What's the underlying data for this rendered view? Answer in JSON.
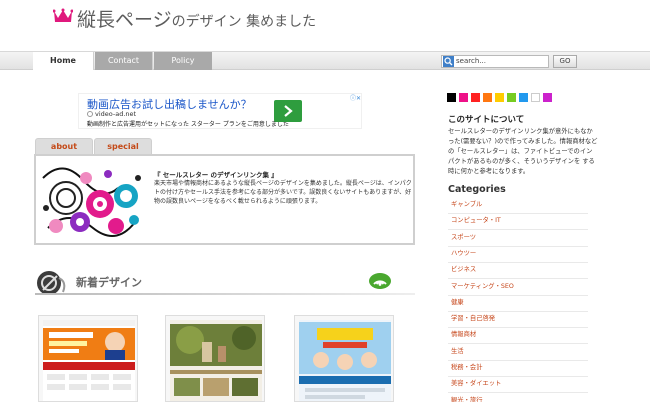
{
  "header": {
    "title_main": "縦長ページ",
    "title_sub": "のデザイン 集めました"
  },
  "nav": {
    "home": "Home",
    "contact": "Contact",
    "policy": "Policy"
  },
  "search": {
    "value": "search...",
    "go": "GO"
  },
  "ad": {
    "headline": "動画広告お試し出稿しませんか？",
    "url": "video-ad.net",
    "description": "動画制作と広告運用がセットになった スターター プランをご用意しました"
  },
  "tabs": {
    "about": "about",
    "special": "special"
  },
  "about_box": {
    "title": "『 セールスレター のデザインリンク集 』",
    "text": "楽天市場や情報商材にあるような縦長ページのデザインを集めました。縦長ページは、インパクトの付け方やセールス手法を参考になる部分が多いです。誤数良くないサイトもありますが、好物の誤数良いページをなるべく載せられるように頑張ります。"
  },
  "new_section": {
    "heading": "新着デザイン"
  },
  "colors": [
    "#000000",
    "#ee1188",
    "#ff2222",
    "#ff7711",
    "#ffcc00",
    "#77cc22",
    "#2299ee",
    "#ffffff",
    "#cc22cc"
  ],
  "sidebar": {
    "about_title": "このサイトについて",
    "about_text": "セールスレターのデザインリンク集が意外にもなかった(需要ない？)ので作ってみました。情報商材などの「セールスレター」は、ファイトビューでのインパクトがあるものが多く、そういうデザインを する時に何かと参考になります。",
    "categories_title": "Categories",
    "categories": [
      "ギャンブル",
      "コンピュータ・IT",
      "スポーツ",
      "ハウツー",
      "ビジネス",
      "マーケティング・SEO",
      "健康",
      "学習・自己啓発",
      "情報商材",
      "生活",
      "税務・会計",
      "美容・ダイエット",
      "観光・旅行"
    ]
  }
}
